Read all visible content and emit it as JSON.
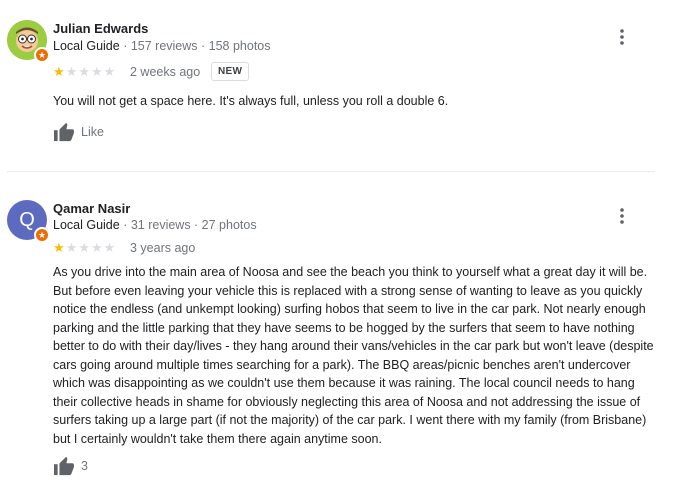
{
  "reviews": [
    {
      "author": "Julian Edwards",
      "guide_label": "Local Guide",
      "stats": " · 157 reviews · 158 photos",
      "rating": 1,
      "date": "2 weeks ago",
      "badge": "NEW",
      "text": "You will not get a space here. It's always full, unless you roll a double 6.",
      "like_label": "Like",
      "avatar_letter": ""
    },
    {
      "author": "Qamar Nasir",
      "guide_label": "Local Guide",
      "stats": " · 31 reviews · 27 photos",
      "rating": 1,
      "date": "3 years ago",
      "badge": "",
      "text": "As you drive into the main area of Noosa and see the beach you think to yourself what a great day it will be. But before even leaving your vehicle this is replaced with a strong sense of wanting to leave as you quickly notice the endless (and unkempt looking) surfing hobos that seem to live in the car park. Not nearly enough parking and the little parking that they have seems to be hogged by the surfers that seem to have nothing better to do with their day/lives - they hang around their vans/vehicles in the car park but won't leave (despite cars going around multiple times searching for a park).   The BBQ areas/picnic benches aren't undercover which was disappointing as we couldn't use them because it was raining. The local council needs to hang their collective heads in shame for obviously neglecting this area of Noosa and not addressing the issue of surfers taking up a large part (if not the majority) of the car park. I went there with my family (from Brisbane) but I certainly wouldn't take them there again anytime soon.",
      "like_label": "3",
      "avatar_letter": "Q"
    }
  ],
  "colors": {
    "star_filled": "#fbbc04",
    "star_empty": "#dadce0",
    "guide_badge": "#ef6c00",
    "avatar_q": "#5c6bc0"
  },
  "icons": {
    "more": "more-vert-icon",
    "like": "thumbs-up-icon",
    "guide": "local-guide-badge-icon",
    "star": "star-icon"
  }
}
